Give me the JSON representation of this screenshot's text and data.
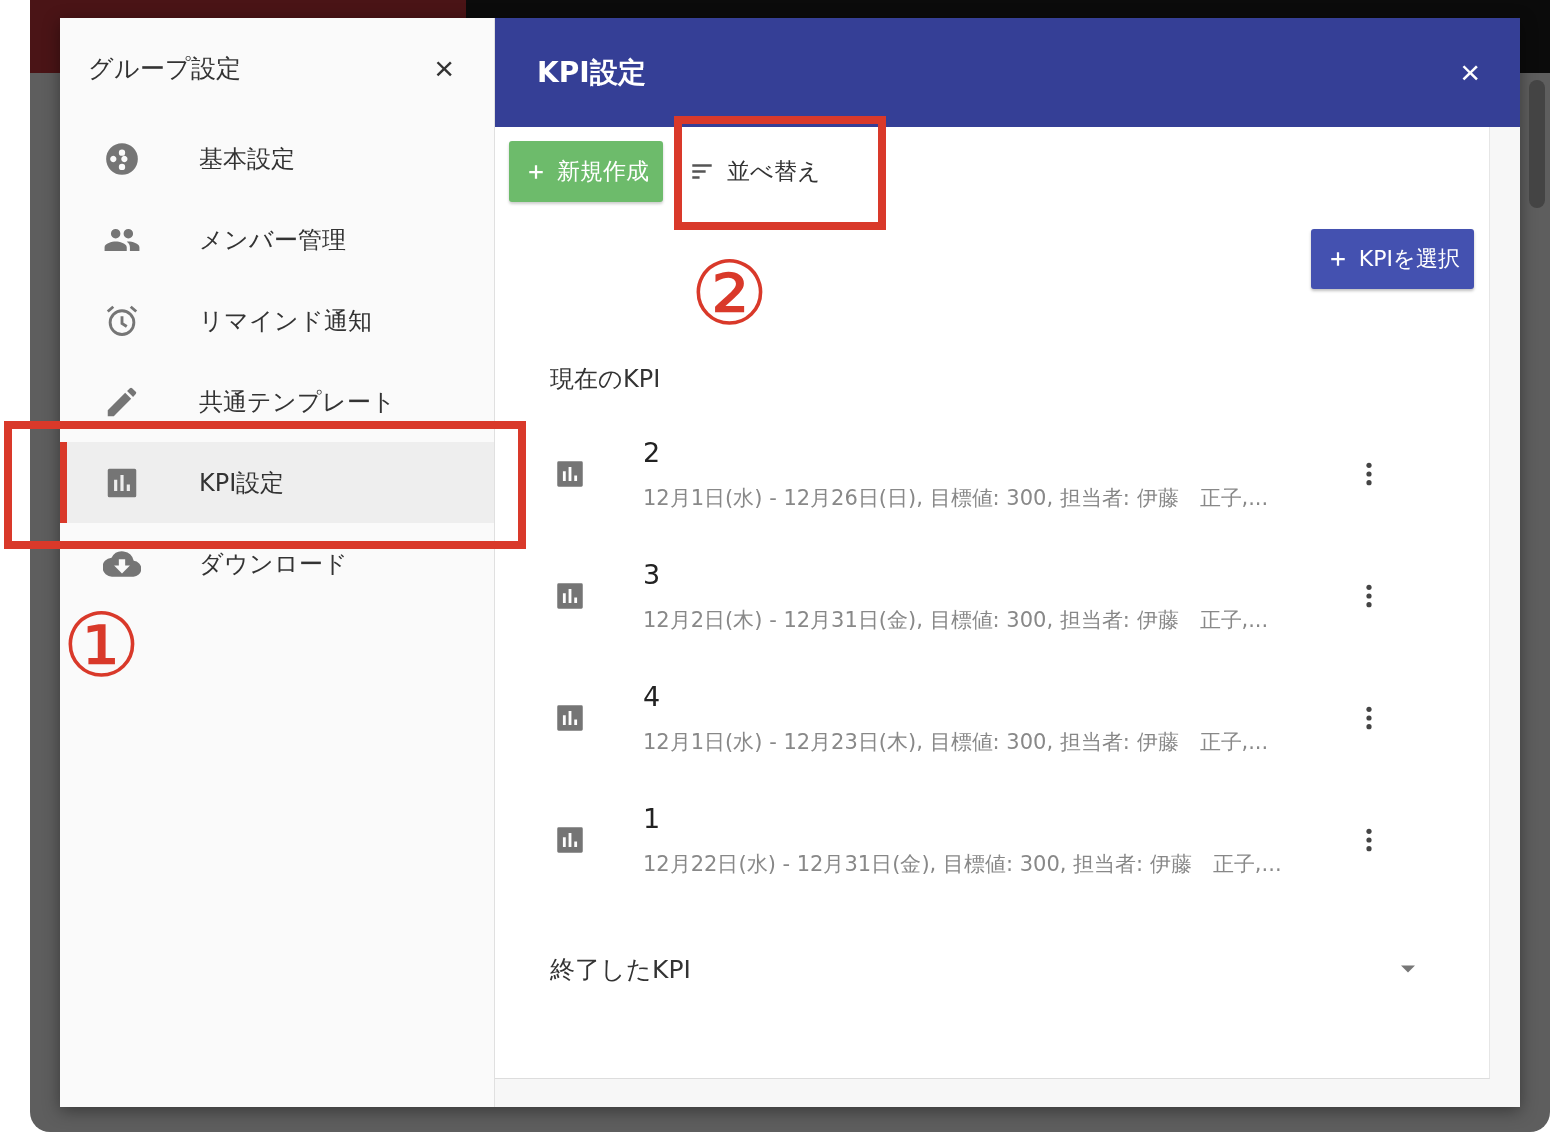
{
  "sidebar": {
    "title": "グループ設定",
    "close": "×",
    "items": [
      {
        "label": "基本設定",
        "selected": false
      },
      {
        "label": "メンバー管理",
        "selected": false
      },
      {
        "label": "リマインド通知",
        "selected": false
      },
      {
        "label": "共通テンプレート",
        "selected": false
      },
      {
        "label": "KPI設定",
        "selected": true
      },
      {
        "label": "ダウンロード",
        "selected": false
      }
    ]
  },
  "dialog": {
    "title": "KPI設定",
    "close": "×",
    "toolbar": {
      "new_button": "新規作成",
      "sort_button": "並べ替え"
    },
    "select_button": "KPIを選択",
    "current_heading": "現在のKPI",
    "kpis": [
      {
        "name": "2",
        "detail": "12月1日(水) - 12月26日(日), 目標値: 300, 担当者: 伊藤　正子,..."
      },
      {
        "name": "3",
        "detail": "12月2日(木) - 12月31日(金), 目標値: 300, 担当者: 伊藤　正子,..."
      },
      {
        "name": "4",
        "detail": "12月1日(水) - 12月23日(木), 目標値: 300, 担当者: 伊藤　正子,..."
      },
      {
        "name": "1",
        "detail": "12月22日(水) - 12月31日(金), 目標値: 300, 担当者: 伊藤　正子,..."
      }
    ],
    "finished_section": {
      "label": "終了したKPI",
      "expanded": false
    }
  },
  "annotations": [
    "①",
    "②"
  ]
}
